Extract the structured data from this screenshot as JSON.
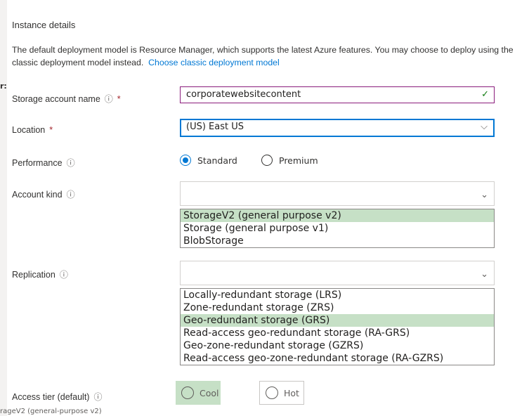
{
  "side_fragment": "r:",
  "bottom_caption": "rageV2 (general-purpose v2)",
  "section_title": "Instance details",
  "description": "The default deployment model is Resource Manager, which supports the latest Azure features. You may choose to deploy using the classic deployment model instead.",
  "description_link": "Choose classic deployment model",
  "fields": {
    "name": {
      "label": "Storage account name",
      "info": "ⓘ",
      "required": "*",
      "value": "corporatewebsitecontent",
      "check": "✓"
    },
    "location": {
      "label": "Location",
      "required": "*",
      "value": "(US) East US",
      "chevron": "⌵"
    },
    "performance": {
      "label": "Performance",
      "info": "ⓘ",
      "options": [
        "Standard",
        "Premium"
      ],
      "selected": "Standard"
    },
    "account_kind": {
      "label": "Account kind",
      "info": "ⓘ",
      "chevron": "⌄",
      "options": [
        "StorageV2 (general purpose v2)",
        "Storage (general purpose v1)",
        "BlobStorage"
      ],
      "selected": "StorageV2 (general purpose v2)"
    },
    "replication": {
      "label": "Replication",
      "info": "ⓘ",
      "chevron": "⌄",
      "options": [
        "Locally-redundant storage (LRS)",
        "Zone-redundant storage (ZRS)",
        "Geo-redundant storage (GRS)",
        "Read-access geo-redundant storage (RA-GRS)",
        "Geo-zone-redundant storage (GZRS)",
        "Read-access geo-zone-redundant storage (RA-GZRS)"
      ],
      "selected": "Geo-redundant storage (GRS)"
    },
    "access_tier": {
      "label": "Access tier (default)",
      "info": "ⓘ",
      "options": [
        "Cool",
        "Hot"
      ],
      "selected": "Cool"
    }
  },
  "colors": {
    "link": "#0078d4",
    "selection_highlight": "#c6e0c6",
    "valid_check": "#107c10",
    "required": "#a4262c"
  }
}
